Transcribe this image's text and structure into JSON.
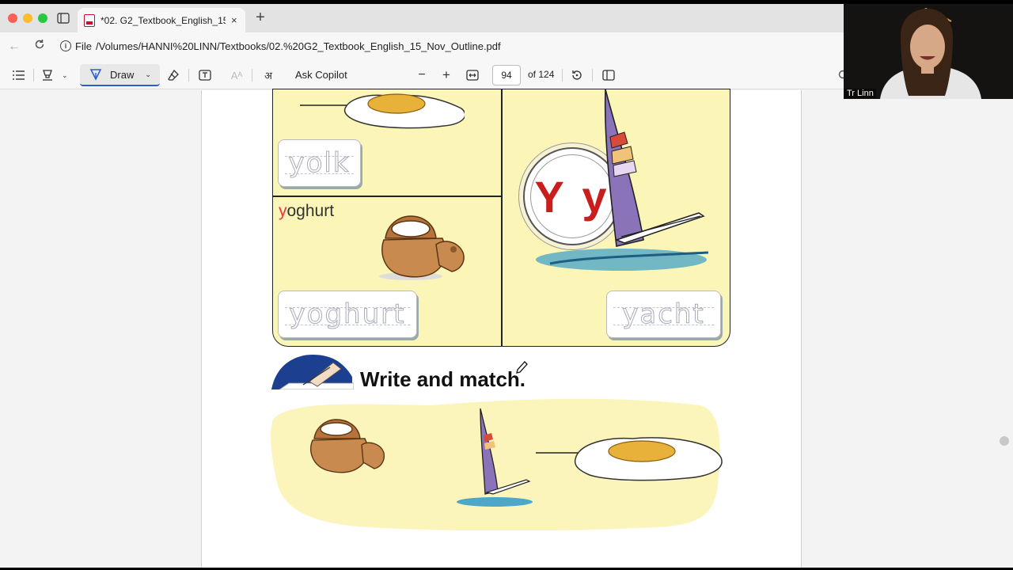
{
  "browser": {
    "tab_title": "*02. G2_Textbook_English_15_N",
    "tab_close_icon": "×",
    "new_tab_icon": "+",
    "address_scheme": "File",
    "address_url": "/Volumes/HANNI%20LINN/Textbooks/02.%20G2_Textbook_English_15_Nov_Outline.pdf"
  },
  "pdf_toolbar": {
    "draw_label": "Draw",
    "copilot_label": "Ask Copilot",
    "current_page": "94",
    "total_pages": "of 124",
    "active_tool_color": "#2b5fcf"
  },
  "page_content": {
    "trace_words": {
      "yolk": "yolk",
      "yoghurt": "yoghurt",
      "yacht": "yacht"
    },
    "label_word_first_letter": "y",
    "label_word_rest": "oghurt",
    "letter_badge": "Y y",
    "activity_title": "Write and match.",
    "badge_color": "#c81e1e",
    "panel_color": "#fbf6b8"
  },
  "webcam": {
    "participant_name": "Tr Linn"
  }
}
